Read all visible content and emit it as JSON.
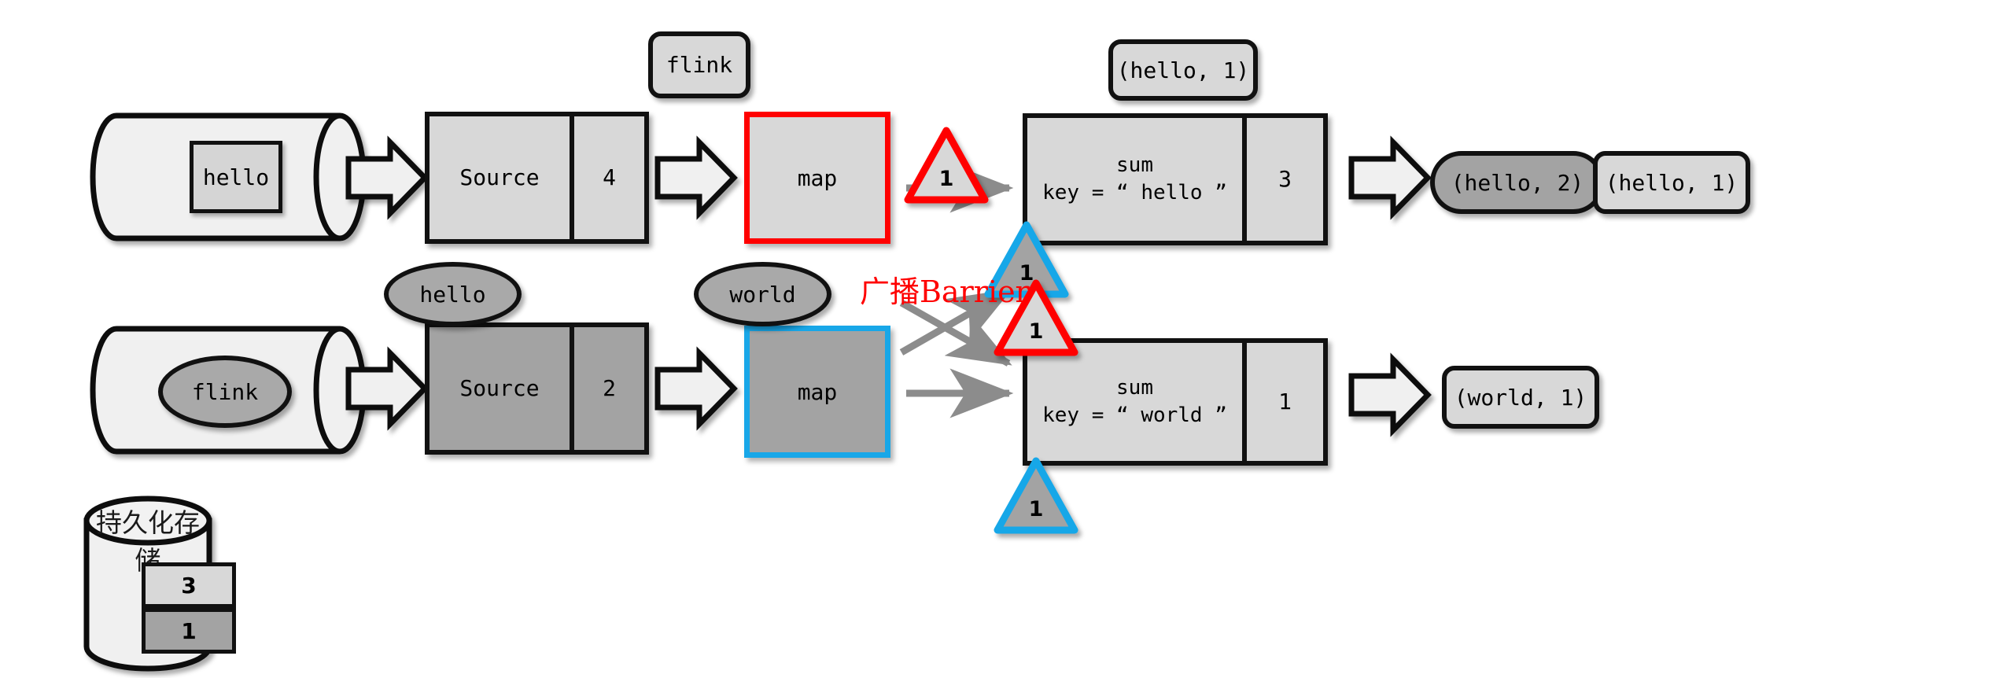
{
  "diagram": {
    "title_annotation": "广播Barrier",
    "colors": {
      "red": "#FF0000",
      "blue": "#18A7E8",
      "gray_arrow": "#8c8c8c",
      "light_fill": "#d8d8d8",
      "mid_fill": "#a9a9a9",
      "dark_outline": "#111111",
      "queue_fill": "#f0f0f0"
    },
    "queues": [
      {
        "name": "input-queue-top",
        "item_label": "hello",
        "item_shape": "square"
      },
      {
        "name": "input-queue-bottom",
        "item_label": "flink",
        "item_shape": "ellipse"
      }
    ],
    "sources": [
      {
        "name": "source-top",
        "label": "Source",
        "count": "4",
        "fill": "light"
      },
      {
        "name": "source-bottom",
        "label": "Source",
        "count": "2",
        "fill": "dark"
      }
    ],
    "maps": [
      {
        "name": "map-top",
        "label": "map",
        "border": "red",
        "fill": "light"
      },
      {
        "name": "map-bottom",
        "label": "map",
        "border": "blue",
        "fill": "dark"
      }
    ],
    "sums": [
      {
        "name": "sum-hello",
        "line1": "sum",
        "line2": "key = “ hello ”",
        "count": "3"
      },
      {
        "name": "sum-world",
        "line1": "sum",
        "line2": "key = “ world ”",
        "count": "1"
      }
    ],
    "floating_labels": [
      {
        "name": "flink-record",
        "label": "flink"
      },
      {
        "name": "hello-tuple-top",
        "label": "(hello, 1)"
      }
    ],
    "emitted_records": [
      {
        "name": "hello-ellipse",
        "label": "hello"
      },
      {
        "name": "world-ellipse",
        "label": "world"
      }
    ],
    "outputs": [
      {
        "name": "output-hello-2",
        "label": "(hello, 2)",
        "style": "pill-dark"
      },
      {
        "name": "output-hello-1",
        "label": "(hello, 1)",
        "style": "rounded-light"
      },
      {
        "name": "output-world-1",
        "label": "(world, 1)",
        "style": "rounded-light"
      }
    ],
    "barriers": [
      {
        "name": "barrier-red-top",
        "label": "1",
        "color": "red"
      },
      {
        "name": "barrier-blue-mid",
        "label": "1",
        "color": "blue"
      },
      {
        "name": "barrier-red-mid",
        "label": "1",
        "color": "red"
      },
      {
        "name": "barrier-blue-bottom",
        "label": "1",
        "color": "blue"
      }
    ],
    "storage": {
      "name": "persistent-storage",
      "title": "持久化存储",
      "cells": [
        {
          "label": "3",
          "fill": "light"
        },
        {
          "label": "1",
          "fill": "dark"
        }
      ]
    }
  }
}
